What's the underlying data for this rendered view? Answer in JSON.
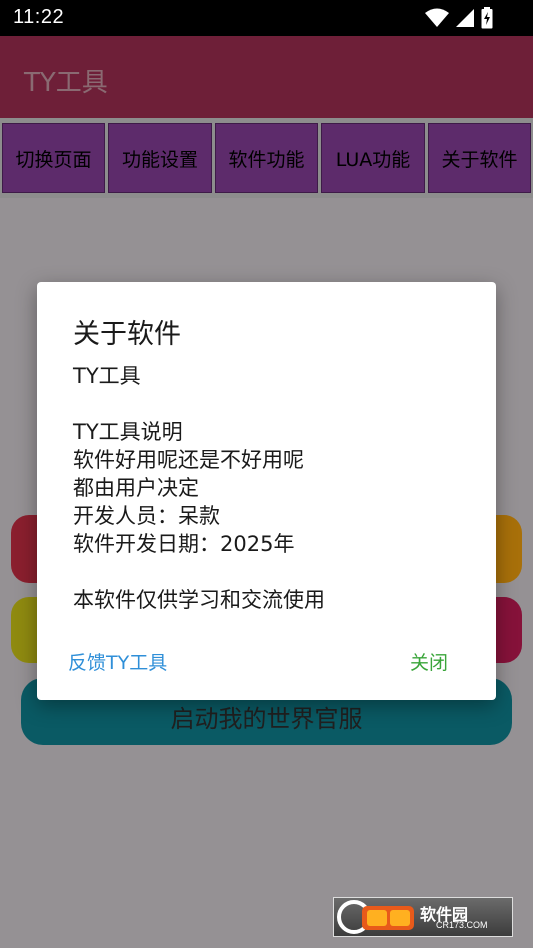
{
  "status_bar": {
    "time": "11:22",
    "icons": [
      "wifi-icon",
      "signal-icon",
      "battery-icon"
    ]
  },
  "app_bar": {
    "title": "TY工具",
    "color": "#6e1f38"
  },
  "tabs": [
    {
      "label": "切换页面"
    },
    {
      "label": "功能设置"
    },
    {
      "label": "软件功能"
    },
    {
      "label": "LUA功能"
    },
    {
      "label": "关于软件"
    }
  ],
  "background_buttons": {
    "big_button_label": "启动我的世界官服"
  },
  "dialog": {
    "title": "关于软件",
    "body_lines": [
      "TY工具",
      "",
      "TY工具说明",
      "软件好用呢还是不好用呢",
      "都由用户决定",
      "开发人员：呆款",
      "软件开发日期：2025年",
      "",
      "本软件仅供学习和交流使用"
    ],
    "feedback_label": "反馈TY工具",
    "close_label": "关闭",
    "feedback_color": "#2f8fd8",
    "close_color": "#3aa53a"
  },
  "watermark": {
    "text": "软件园",
    "sub": "CR173.COM"
  }
}
